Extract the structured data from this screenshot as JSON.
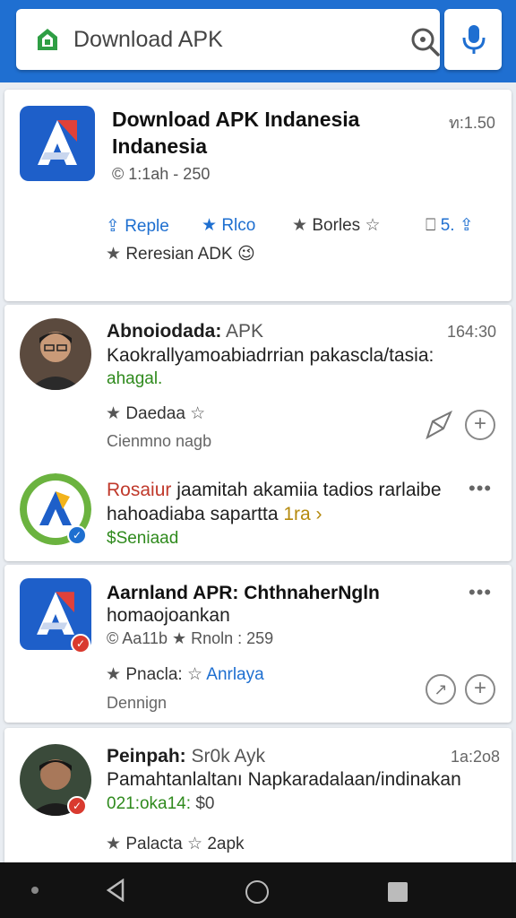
{
  "search": {
    "text": "Download APK"
  },
  "cards": [
    {
      "title_line1": "Download APK Indanesia",
      "title_line2": "Indanesia",
      "time": "ท:1.50",
      "meta": "© 1:1ah - 250",
      "actions": {
        "reply": "Reple",
        "like": "Rlco",
        "borles": "Borles",
        "count": "5."
      },
      "sub": "Reresian ADK 😉"
    },
    {
      "name": "Abnoiodada:",
      "name_suffix": "APK",
      "time": "164:30",
      "body": "Kaokrallyamoabiadrrian pakascla/tasia:",
      "link": "ahagal.",
      "rating": "Daedaa",
      "caption": "Cienmno nagb"
    },
    {
      "name_colored": "Rosaiur",
      "body1": "jaamitah akamiia tadios rarlaibe",
      "body2": "hahoadiaba sapartta",
      "body2_tail": "1ra",
      "link": "$Seniaad"
    },
    {
      "title": "Aarnland APR: ChthnaherNgln",
      "sub": "homaojoankan",
      "meta": "© Aa11b ★ Rnoln : 259",
      "rating": "Pnacla:",
      "rating_link": "Anrlaya",
      "caption": "Dennign"
    },
    {
      "name": "Peinpah:",
      "name_suffix": "Sr0k Ayk",
      "time": "1a:2o8",
      "body": "Pamahtanlaltanı Napkaradalaan/indinakan",
      "highlight": "021:oka14:",
      "highlight_tail": "$0",
      "rating": "Palacta",
      "rating_tail": "2apk"
    }
  ],
  "colors": {
    "accent": "#1f6fd1",
    "link_green": "#2f8a1d",
    "alert_red": "#c0392b"
  }
}
